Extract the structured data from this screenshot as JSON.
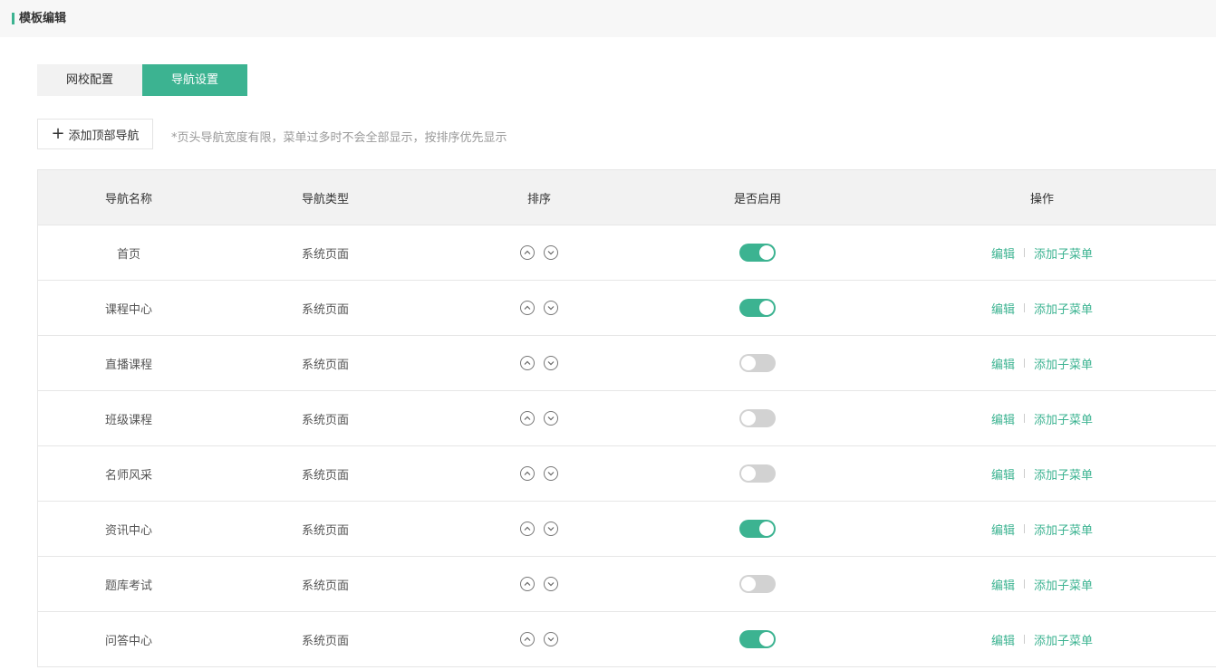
{
  "header": {
    "title": "模板编辑"
  },
  "tabs": [
    {
      "label": "网校配置",
      "active": false
    },
    {
      "label": "导航设置",
      "active": true
    }
  ],
  "toolbar": {
    "add_label": "添加顶部导航",
    "hint": "*页头导航宽度有限，菜单过多时不会全部显示，按排序优先显示"
  },
  "table": {
    "columns": [
      "导航名称",
      "导航类型",
      "排序",
      "是否启用",
      "操作"
    ],
    "rows": [
      {
        "name": "首页",
        "type": "系统页面",
        "enabled": true
      },
      {
        "name": "课程中心",
        "type": "系统页面",
        "enabled": true
      },
      {
        "name": "直播课程",
        "type": "系统页面",
        "enabled": false
      },
      {
        "name": "班级课程",
        "type": "系统页面",
        "enabled": false
      },
      {
        "name": "名师风采",
        "type": "系统页面",
        "enabled": false
      },
      {
        "name": "资讯中心",
        "type": "系统页面",
        "enabled": true
      },
      {
        "name": "题库考试",
        "type": "系统页面",
        "enabled": false
      },
      {
        "name": "问答中心",
        "type": "系统页面",
        "enabled": true
      }
    ],
    "actions": {
      "edit": "编辑",
      "add_sub": "添加子菜单"
    }
  },
  "colors": {
    "accent": "#3cb391",
    "switch_off": "#d2d2d2"
  }
}
